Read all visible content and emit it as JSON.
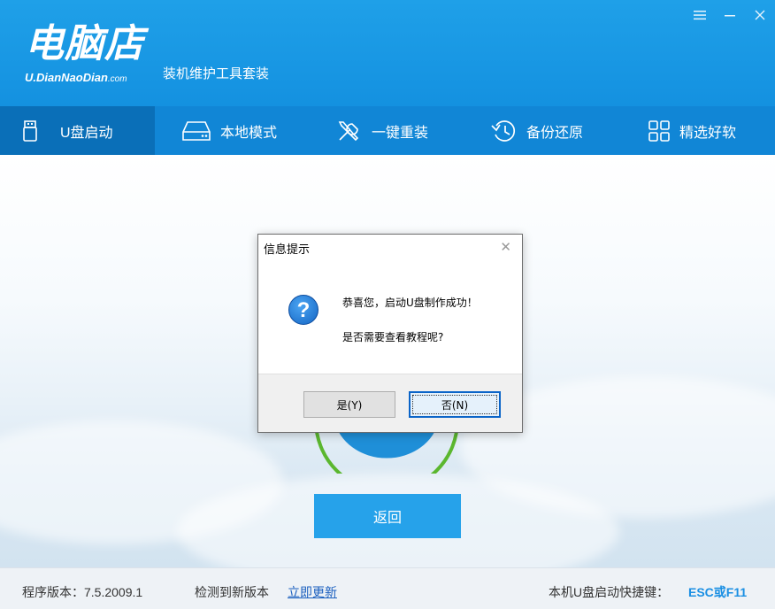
{
  "app": {
    "logo_text": "电脑店",
    "logo_url": "U.DianNaoDian",
    "logo_url_suffix": ".com",
    "subtitle": "装机维护工具套装"
  },
  "window_controls": {
    "menu_icon": "menu-icon",
    "minimize_icon": "minimize-icon",
    "close_icon": "close-icon"
  },
  "nav": {
    "items": [
      {
        "label": "U盘启动",
        "icon": "usb-drive-icon",
        "active": true
      },
      {
        "label": "本地模式",
        "icon": "hard-disk-icon",
        "active": false
      },
      {
        "label": "一键重装",
        "icon": "tools-icon",
        "active": false
      },
      {
        "label": "备份还原",
        "icon": "restore-clock-icon",
        "active": false
      },
      {
        "label": "精选好软",
        "icon": "apps-grid-icon",
        "active": false
      }
    ]
  },
  "main": {
    "back_label": "返回"
  },
  "dialog": {
    "title": "信息提示",
    "message_line1": "恭喜您，启动U盘制作成功！",
    "message_line2": "是否需要查看教程呢?",
    "yes_label": "是(Y)",
    "no_label": "否(N)",
    "icon": "question-icon"
  },
  "footer": {
    "version_label": "程序版本：7.5.2009.1",
    "new_version_label": "检测到新版本",
    "update_link": "立即更新",
    "hotkey_label": "本机U盘启动快捷键：",
    "hotkey_value": "ESC或F11"
  },
  "colors": {
    "header": "#1a9ae4",
    "nav": "#1186d6",
    "nav_active": "#0a6fb8",
    "button": "#26a2ea",
    "progress_ring": "#5bb72f",
    "hotkey": "#1a8fe3"
  }
}
